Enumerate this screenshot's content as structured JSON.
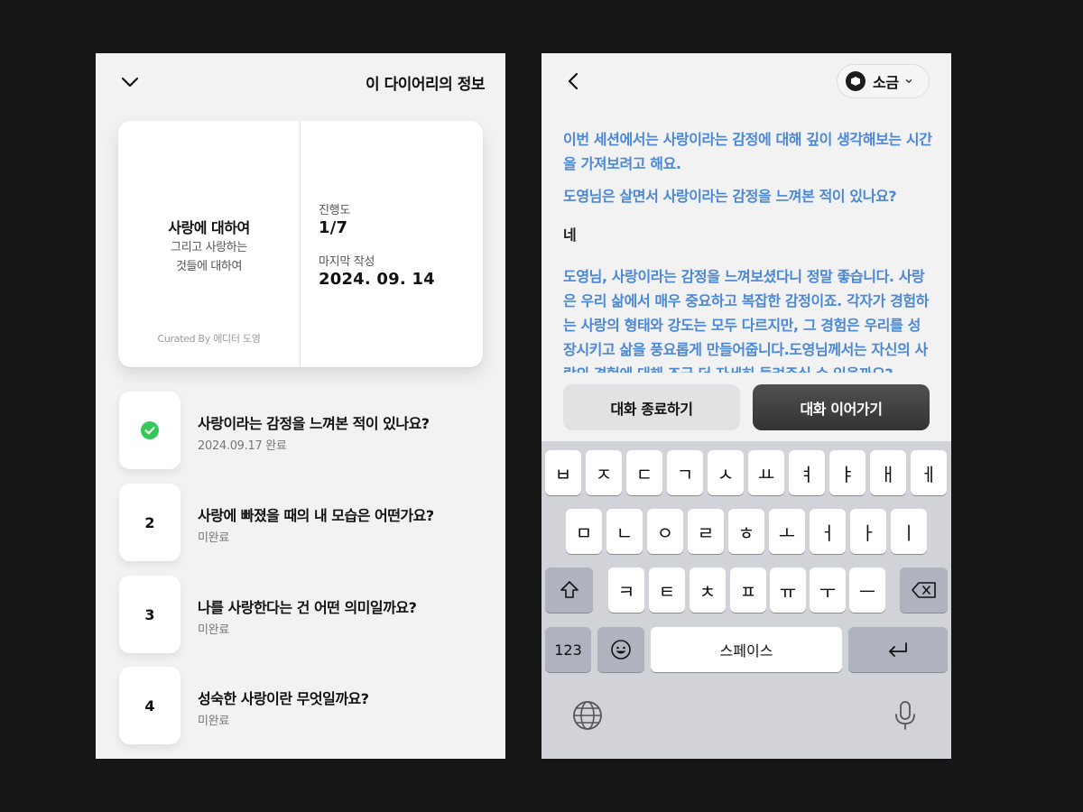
{
  "left": {
    "header": {
      "title": "이 다이어리의 정보"
    },
    "book": {
      "title": "사랑에 대하여",
      "subtitle_line1": "그리고 사랑하는",
      "subtitle_line2": "것들에 대하여",
      "curator": "Curated By 에디터 도영",
      "progress_label": "진행도",
      "progress_value": "1/7",
      "last_label": "마지막 작성",
      "last_value": "2024. 09. 14"
    },
    "questions": [
      {
        "badge": "",
        "done": true,
        "title": "사랑이라는 감정을 느껴본 적이 있나요?",
        "status": "2024.09.17 완료"
      },
      {
        "badge": "2",
        "done": false,
        "title": "사랑에 빠졌을 때의 내 모습은 어떤가요?",
        "status": "미완료"
      },
      {
        "badge": "3",
        "done": false,
        "title": "나를 사랑한다는 건 어떤 의미일까요?",
        "status": "미완료"
      },
      {
        "badge": "4",
        "done": false,
        "title": "성숙한 사랑이란 무엇일까요?",
        "status": "미완료"
      }
    ]
  },
  "right": {
    "model": {
      "name": "소금"
    },
    "messages": [
      {
        "role": "ai",
        "text": "이번 세션에서는 사랑이라는 감정에 대해 깊이 생각해보는 시간을 가져보려고 해요."
      },
      {
        "role": "ai",
        "text": "도영님은 살면서 사랑이라는 감정을 느껴본 적이 있나요?"
      },
      {
        "role": "user",
        "text": "네"
      },
      {
        "role": "ai",
        "text": "도영님, 사랑이라는 감정을 느껴보셨다니 정말 좋습니다. 사랑은 우리 삶에서 매우 중요하고 복잡한 감정이죠. 각자가 경험하는 사랑의 형태와 강도는 모두 다르지만, 그 경험은 우리를 성장시키고 삶을 풍요롭게 만들어줍니다.도영님께서는 자신의 사랑의 경험에 대해 조금 더 자세히 들려주실 수 있을까요?"
      }
    ],
    "buttons": {
      "end": "대화 종료하기",
      "continue": "대화 이어가기"
    },
    "keyboard": {
      "row1": [
        "ㅂ",
        "ㅈ",
        "ㄷ",
        "ㄱ",
        "ㅅ",
        "ㅛ",
        "ㅕ",
        "ㅑ",
        "ㅐ",
        "ㅔ"
      ],
      "row2": [
        "ㅁ",
        "ㄴ",
        "ㅇ",
        "ㄹ",
        "ㅎ",
        "ㅗ",
        "ㅓ",
        "ㅏ",
        "ㅣ"
      ],
      "row3": [
        "ㅋ",
        "ㅌ",
        "ㅊ",
        "ㅍ",
        "ㅠ",
        "ㅜ",
        "ㅡ"
      ],
      "numbers": "123",
      "space": "스페이스"
    },
    "colors": {
      "ai_text": "#4a87d6",
      "check": "#34c759"
    }
  }
}
